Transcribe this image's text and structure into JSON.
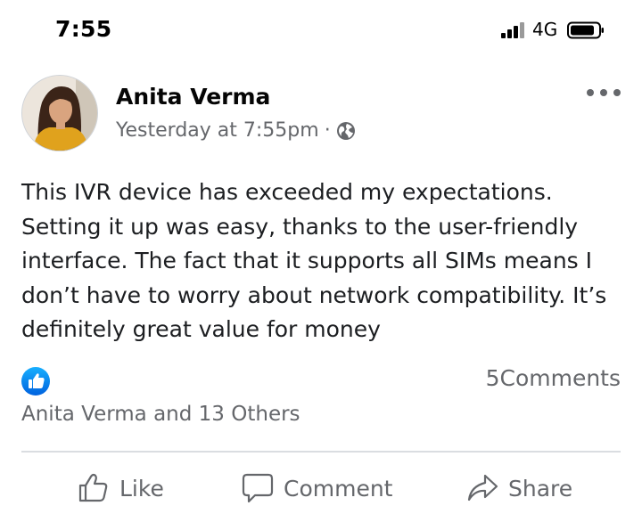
{
  "status_bar": {
    "time": "7:55",
    "network": "4G"
  },
  "post": {
    "author": "Anita Verma",
    "timestamp": "Yesterday at 7:55pm",
    "separator": "·",
    "audience_icon": "globe-icon",
    "text": "This IVR device has exceeded my expectations. Setting it up was easy, thanks to the user-friendly interface. The fact that it supports all SIMs means I don’t have to worry about network compatibility. It’s definitely great value for money",
    "reaction_icon": "like-badge-icon",
    "reactors": "Anita Verma and 13 Others",
    "comments": "5Comments"
  },
  "actions": {
    "like": "Like",
    "comment": "Comment",
    "share": "Share"
  },
  "colors": {
    "accent": "#1877f2",
    "secondary_text": "#65676b",
    "primary_text": "#1c1e21",
    "divider": "#dadde1"
  }
}
